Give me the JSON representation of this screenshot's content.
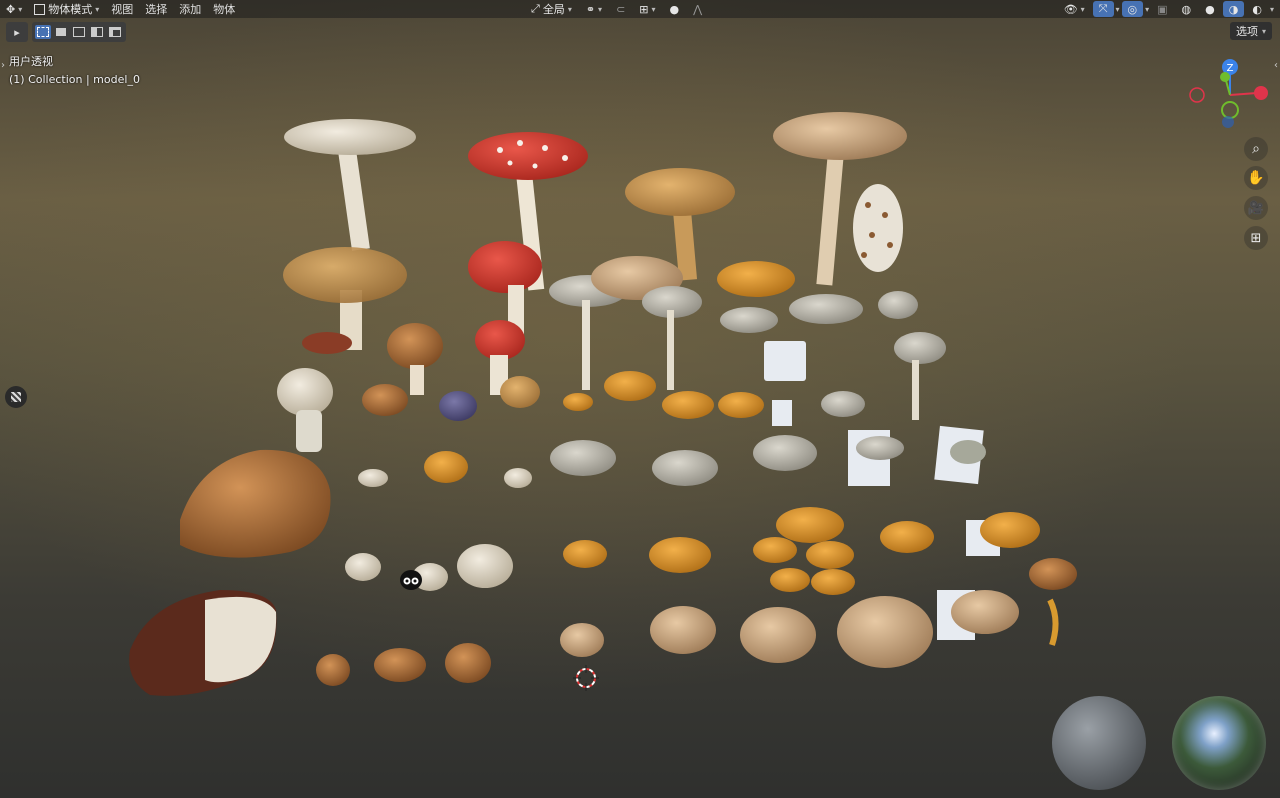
{
  "header": {
    "editor_type_icon": "3d-viewport-icon",
    "mode_label": "物体模式",
    "menus": [
      "视图",
      "选择",
      "添加",
      "物体"
    ],
    "transform_orientation_label": "全局",
    "options_label": "选项"
  },
  "overlay_text": {
    "view_name": "用户透视",
    "collection_info": "(1) Collection | model_0"
  },
  "gizmo": {
    "z_label": "Z",
    "x_color": "#e0344b",
    "y_color": "#6fbd2c",
    "z_color": "#3b83e9"
  },
  "colors": {
    "accent": "#4772b3",
    "header_bg": "#1e1e1e"
  }
}
